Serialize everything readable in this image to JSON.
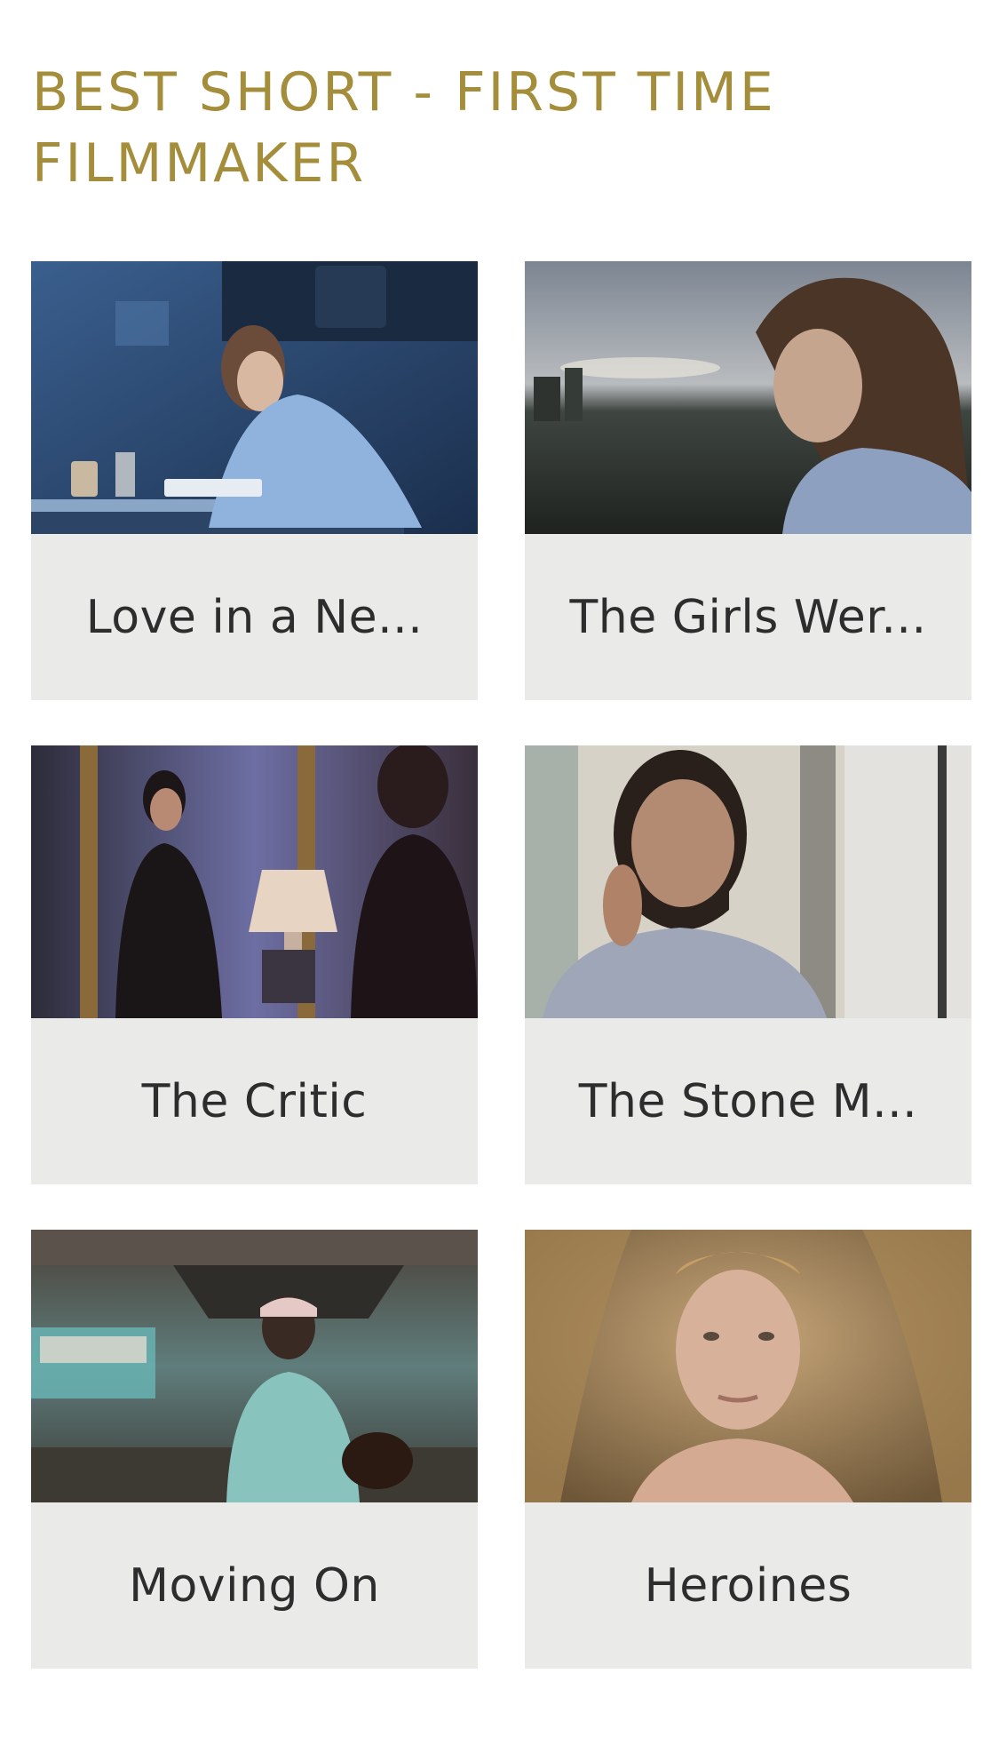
{
  "header": {
    "title_line1": "BEST SHORT - FIRST TIME",
    "title_line2": "FILMMAKER"
  },
  "colors": {
    "title": "#A48E3B",
    "caption_bg": "#EAEAE8",
    "caption_text": "#2D2D2D"
  },
  "films": [
    {
      "title": "Love in a Ne..."
    },
    {
      "title": "The Girls Wer..."
    },
    {
      "title": "The Critic"
    },
    {
      "title": "The Stone M..."
    },
    {
      "title": "Moving On"
    },
    {
      "title": "Heroines"
    }
  ]
}
